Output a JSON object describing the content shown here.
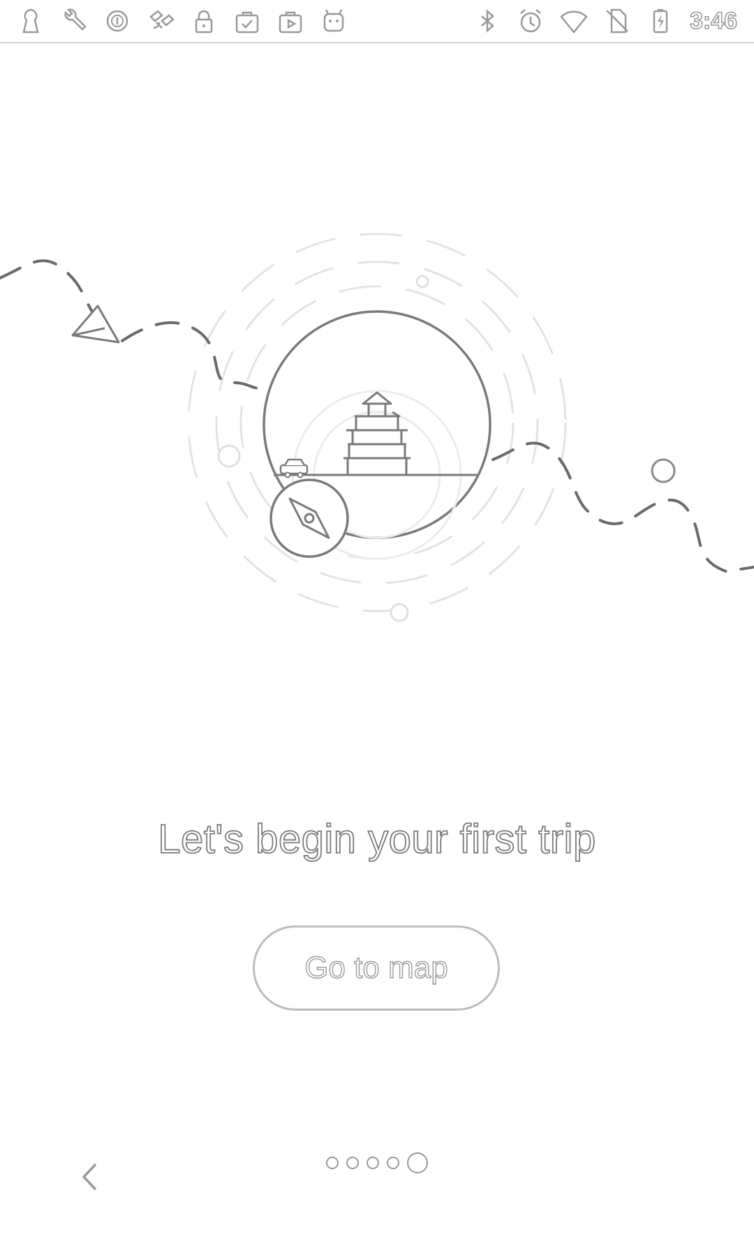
{
  "status_bar": {
    "time": "3:46",
    "left_icons": [
      "keyhole-icon",
      "wrench-icon",
      "circle-i-icon",
      "satellite-icon",
      "lock-icon",
      "checklist-bag-icon",
      "play-bag-icon",
      "android-robot-icon"
    ],
    "right_icons": [
      "bluetooth-icon",
      "alarm-icon",
      "wifi-icon",
      "no-sim-icon",
      "battery-charging-icon"
    ]
  },
  "onboarding": {
    "headline": "Let's begin your first trip",
    "cta_label": "Go to map",
    "page_count": 5,
    "active_page": 5
  },
  "colors": {
    "background": "#ffffff",
    "line": "#7a7a7a",
    "light_line": "#dcdcdc"
  }
}
